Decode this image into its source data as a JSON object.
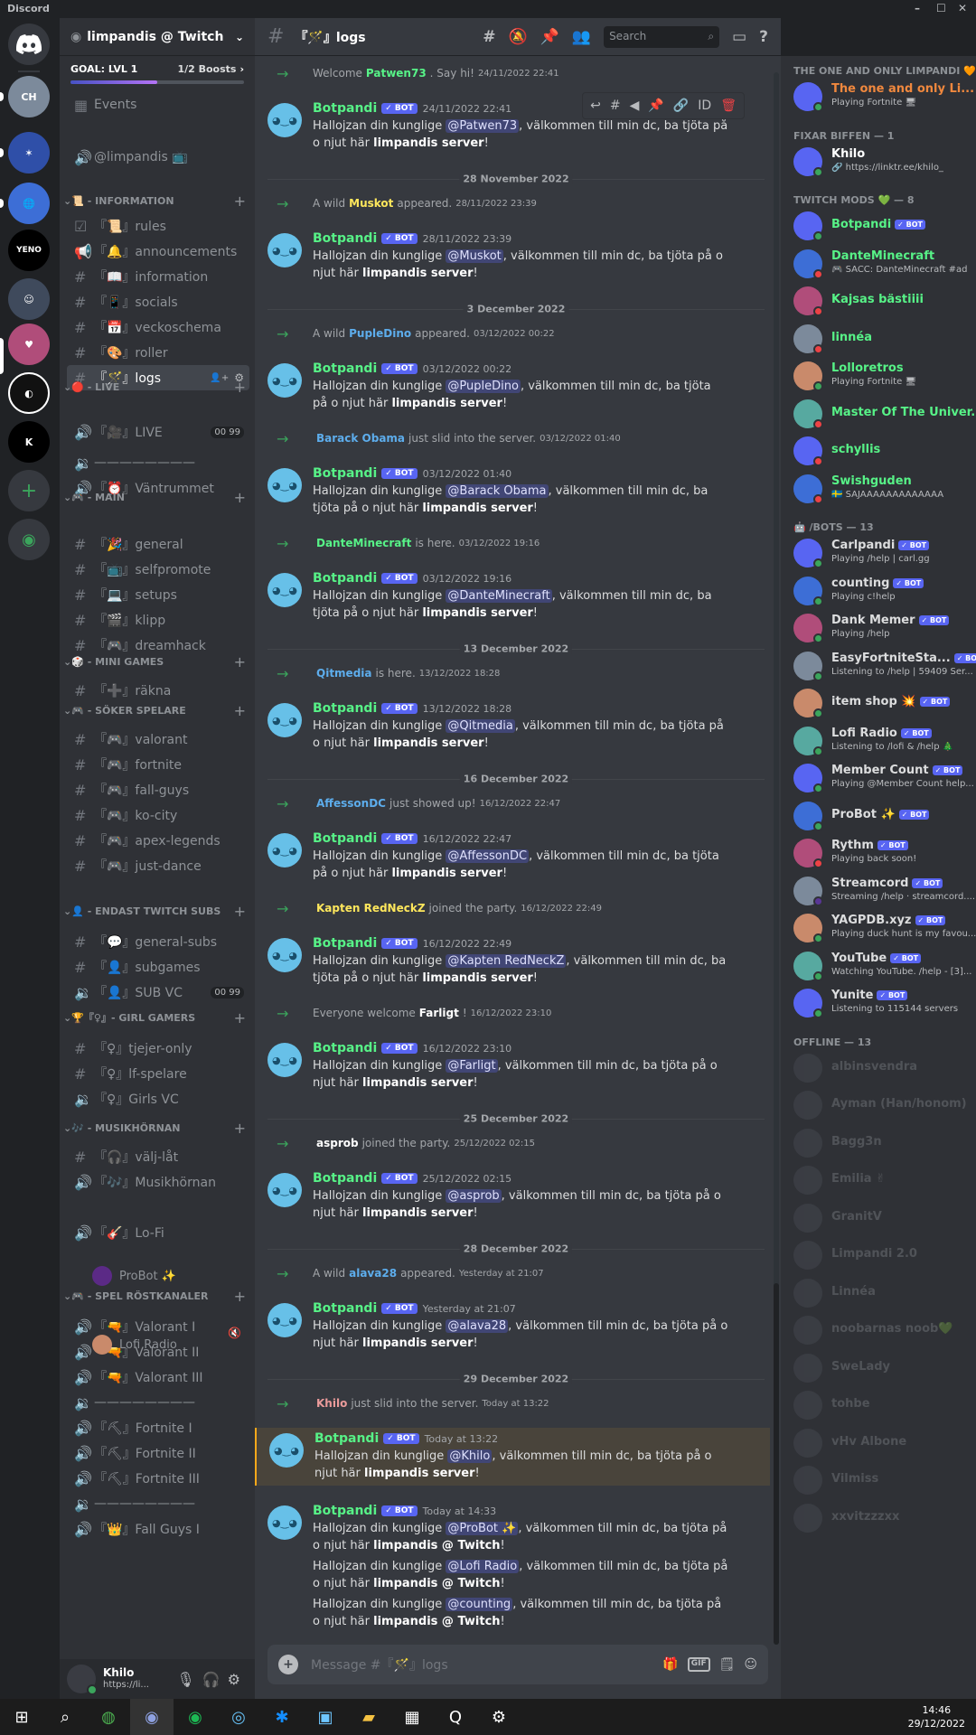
{
  "window": {
    "title": "Discord"
  },
  "server": {
    "name": "limpandis @ Twitch",
    "goal": "GOAL: LVL 1",
    "boosts": "1/2 Boosts",
    "goal_progress": 0.5
  },
  "channel_list": {
    "top": [
      {
        "label": "Events",
        "icon": "calendar-icon"
      },
      {
        "label": "@limpandis 📺",
        "icon": "voice-icon"
      }
    ],
    "categories": [
      {
        "name": "📜 - INFORMATION",
        "channels": [
          {
            "label": "『📜』rules",
            "icon": "checkbox-icon"
          },
          {
            "label": "『🔔』announcements",
            "icon": "megaphone-icon"
          },
          {
            "label": "『📖』information",
            "icon": "hash-icon"
          },
          {
            "label": "『📱』socials",
            "icon": "hash-icon"
          },
          {
            "label": "『📅』veckoschema",
            "icon": "hash-icon"
          },
          {
            "label": "『🎨』roller",
            "icon": "hash-icon"
          },
          {
            "label": "『🪄』logs",
            "icon": "hash-icon",
            "active": true
          }
        ]
      },
      {
        "name": "🔴 - LIVE",
        "channels": [
          {
            "label": "『🎥』LIVE",
            "icon": "speaker-icon",
            "badge_a": "00",
            "badge_b": "99"
          },
          {
            "label": "————————",
            "icon": "voice-lock-icon"
          },
          {
            "label": "『⏰』Väntrummet",
            "icon": "speaker-icon"
          }
        ]
      },
      {
        "name": "🎮 - MAIN",
        "channels": [
          {
            "label": "『🎉』general",
            "icon": "hash-icon"
          },
          {
            "label": "『📺』selfpromote",
            "icon": "hash-icon"
          },
          {
            "label": "『💻』setups",
            "icon": "hash-icon"
          },
          {
            "label": "『🎬』klipp",
            "icon": "hash-icon"
          },
          {
            "label": "『🎮』dreamhack",
            "icon": "hash-icon"
          }
        ]
      },
      {
        "name": "🎲 - MINI GAMES",
        "channels": [
          {
            "label": "『➕』räkna",
            "icon": "hash-icon"
          }
        ]
      },
      {
        "name": "🎮 - SÖKER SPELARE",
        "channels": [
          {
            "label": "『🎮』valorant",
            "icon": "hash-icon"
          },
          {
            "label": "『🎮』fortnite",
            "icon": "hash-icon"
          },
          {
            "label": "『🎮』fall-guys",
            "icon": "hash-icon"
          },
          {
            "label": "『🎮』ko-city",
            "icon": "hash-icon"
          },
          {
            "label": "『🎮』apex-legends",
            "icon": "hash-icon"
          },
          {
            "label": "『🎮』just-dance",
            "icon": "hash-icon"
          }
        ]
      },
      {
        "name": "👤 - ENDAST TWITCH SUBS",
        "channels": [
          {
            "label": "『💬』general-subs",
            "icon": "hash-icon"
          },
          {
            "label": "『👤』subgames",
            "icon": "hash-icon"
          },
          {
            "label": "『👤』SUB VC",
            "icon": "voice-lock-icon",
            "badge_a": "00",
            "badge_b": "99"
          }
        ]
      },
      {
        "name": "🏆『♀』- GIRL GAMERS",
        "channels": [
          {
            "label": "『♀』tjejer-only",
            "icon": "hash-icon"
          },
          {
            "label": "『♀』lf-spelare",
            "icon": "hash-icon"
          },
          {
            "label": "『♀』Girls VC",
            "icon": "voice-lock-icon"
          }
        ]
      },
      {
        "name": "🎶 - MUSIKHÖRNAN",
        "channels": [
          {
            "label": "『🎧』välj-låt",
            "icon": "hash-icon"
          },
          {
            "label": "『🎶』Musikhörnan",
            "icon": "speaker-icon"
          },
          {
            "label": "『🎸』Lo-Fi",
            "icon": "speaker-icon"
          }
        ]
      },
      {
        "name": "🎮 - SPEL RÖSTKANALER",
        "channels": [
          {
            "label": "『🔫』Valorant I",
            "icon": "speaker-icon"
          },
          {
            "label": "『🔫』Valorant II",
            "icon": "speaker-icon"
          },
          {
            "label": "『🔫』Valorant III",
            "icon": "speaker-icon"
          },
          {
            "label": "————————",
            "icon": "voice-lock-icon"
          },
          {
            "label": "『⛏』Fortnite I",
            "icon": "speaker-icon"
          },
          {
            "label": "『⛏』Fortnite II",
            "icon": "speaker-icon"
          },
          {
            "label": "『⛏』Fortnite III",
            "icon": "speaker-icon"
          },
          {
            "label": "————————",
            "icon": "voice-lock-icon"
          },
          {
            "label": "『👑』Fall Guys I",
            "icon": "speaker-icon"
          }
        ]
      }
    ],
    "voice_users": [
      {
        "name": "ProBot ✨"
      },
      {
        "name": "Lofi Radio"
      }
    ]
  },
  "user": {
    "name": "Khilo",
    "status": "https://li..."
  },
  "chat": {
    "channel": "『🪄』logs",
    "search_placeholder": "Search",
    "composer_placeholder": "Message #『🪄』logs",
    "bot_tag": "✓ BOT",
    "welcome_text": "Hallojzan din kunglige",
    "welcome_tail": ", välkommen till min dc, ba tjöta på o njut här",
    "items": [
      {
        "kind": "join",
        "pre": "Welcome",
        "name": "Patwen73",
        "post": ". Say hi!",
        "ts": "24/11/2022 22:41",
        "color": "#57f287"
      },
      {
        "kind": "bot",
        "ts": "24/11/2022 22:41",
        "mention": "@Patwen73",
        "server": "limpandis server"
      },
      {
        "kind": "divider",
        "date": "28 November 2022"
      },
      {
        "kind": "join",
        "pre": "A wild",
        "name": "Muskot",
        "post": "appeared.",
        "ts": "28/11/2022 23:39",
        "color": "#fee75c"
      },
      {
        "kind": "bot",
        "ts": "28/11/2022 23:39",
        "mention": "@Muskot",
        "server": "limpandis server"
      },
      {
        "kind": "divider",
        "date": "3 December 2022"
      },
      {
        "kind": "join",
        "pre": "A wild",
        "name": "PupleDino",
        "post": "appeared.",
        "ts": "03/12/2022 00:22",
        "color": "#5dadec"
      },
      {
        "kind": "bot",
        "ts": "03/12/2022 00:22",
        "mention": "@PupleDino",
        "server": "limpandis server"
      },
      {
        "kind": "join",
        "pre": "",
        "name": "Barack Obama",
        "post": "just slid into the server.",
        "ts": "03/12/2022 01:40",
        "color": "#5dadec"
      },
      {
        "kind": "bot",
        "ts": "03/12/2022 01:40",
        "mention": "@Barack Obama",
        "server": "limpandis server"
      },
      {
        "kind": "join",
        "pre": "",
        "name": "DanteMinecraft",
        "post": "is here.",
        "ts": "03/12/2022 19:16",
        "color": "#57f287"
      },
      {
        "kind": "bot",
        "ts": "03/12/2022 19:16",
        "mention": "@DanteMinecraft",
        "server": "limpandis server"
      },
      {
        "kind": "divider",
        "date": "13 December 2022"
      },
      {
        "kind": "join",
        "pre": "",
        "name": "Qitmedia",
        "post": "is here.",
        "ts": "13/12/2022 18:28",
        "color": "#5dadec"
      },
      {
        "kind": "bot",
        "ts": "13/12/2022 18:28",
        "mention": "@Qitmedia",
        "server": "limpandis server"
      },
      {
        "kind": "divider",
        "date": "16 December 2022"
      },
      {
        "kind": "join",
        "pre": "",
        "name": "AffessonDC",
        "post": "just showed up!",
        "ts": "16/12/2022 22:47",
        "color": "#5dadec"
      },
      {
        "kind": "bot",
        "ts": "16/12/2022 22:47",
        "mention": "@AffessonDC",
        "server": "limpandis server"
      },
      {
        "kind": "join",
        "pre": "",
        "name": "Kapten RedNeckZ",
        "post": "joined the party.",
        "ts": "16/12/2022 22:49",
        "color": "#fee75c"
      },
      {
        "kind": "bot",
        "ts": "16/12/2022 22:49",
        "mention": "@Kapten RedNeckZ",
        "server": "limpandis server"
      },
      {
        "kind": "join",
        "pre": "Everyone welcome",
        "name": "Farligt",
        "post": "!",
        "ts": "16/12/2022 23:10",
        "color": "#ffffff"
      },
      {
        "kind": "bot",
        "ts": "16/12/2022 23:10",
        "mention": "@Farligt",
        "server": "limpandis server"
      },
      {
        "kind": "divider",
        "date": "25 December 2022"
      },
      {
        "kind": "join",
        "pre": "",
        "name": "asprob",
        "post": "joined the party.",
        "ts": "25/12/2022 02:15",
        "color": "#ffffff"
      },
      {
        "kind": "bot",
        "ts": "25/12/2022 02:15",
        "mention": "@asprob",
        "server": "limpandis server"
      },
      {
        "kind": "divider",
        "date": "28 December 2022"
      },
      {
        "kind": "join",
        "pre": "A wild",
        "name": "alava28",
        "post": "appeared.",
        "ts": "Yesterday at 21:07",
        "color": "#5dadec"
      },
      {
        "kind": "bot",
        "ts": "Yesterday at 21:07",
        "mention": "@alava28",
        "server": "limpandis server"
      },
      {
        "kind": "divider",
        "date": "29 December 2022"
      },
      {
        "kind": "join",
        "pre": "",
        "name": "Khilo",
        "post": "just slid into the server.",
        "ts": "Today at 13:22",
        "color": "#eb9b9b"
      },
      {
        "kind": "bot",
        "ts": "Today at 13:22",
        "mention": "@Khilo",
        "server": "limpandis server",
        "highlight": true
      },
      {
        "kind": "bot3",
        "ts": "Today at 14:33",
        "mentions": [
          "@ProBot ✨",
          "@Lofi Radio",
          "@counting"
        ],
        "server": "limpandis @ Twitch"
      }
    ]
  },
  "members": {
    "groups": [
      {
        "title": "THE ONE AND ONLY LIMPANDI 🧡 — 1",
        "list": [
          {
            "name": "The one and only Li...",
            "sub": "Playing Fortnite 🖥",
            "color": "#f0883e",
            "status": "#3ba55c"
          }
        ]
      },
      {
        "title": "FIXAR BIFFEN — 1",
        "list": [
          {
            "name": "Khilo",
            "sub": "🔗 https://linktr.ee/khilo_",
            "color": "#ffffff",
            "status": "#3ba55c"
          }
        ]
      },
      {
        "title": "TWITCH MODS 💚 — 8",
        "list": [
          {
            "name": "Botpandi",
            "bot": true,
            "color": "#57f287",
            "status": "#3ba55c"
          },
          {
            "name": "DanteMinecraft",
            "sub": "🎮 SACC: DanteMinecraft #ad",
            "color": "#57f287",
            "status": "#ed4245"
          },
          {
            "name": "Kajsas bästiiii",
            "color": "#57f287",
            "status": "#ed4245"
          },
          {
            "name": "linnéa",
            "color": "#57f287",
            "status": "#ed4245"
          },
          {
            "name": "Lolloretros",
            "sub": "Playing Fortnite 🖥",
            "color": "#57f287",
            "status": "#3ba55c"
          },
          {
            "name": "Master Of The Univer...",
            "color": "#57f287",
            "status": "#ed4245"
          },
          {
            "name": "schyllis",
            "color": "#57f287",
            "status": "#ed4245"
          },
          {
            "name": "Swishguden",
            "sub": "🇸🇪 SÄJAAAAAAAAAAAAA",
            "color": "#57f287",
            "status": "#ed4245"
          }
        ]
      },
      {
        "title": "🤖 /BOTS — 13",
        "list": [
          {
            "name": "Carlpandi",
            "bot": true,
            "sub": "Playing /help | carl.gg",
            "color": "#dcddde",
            "status": "#3ba55c"
          },
          {
            "name": "counting",
            "bot": true,
            "sub": "Playing c!help",
            "color": "#dcddde",
            "status": "#3ba55c"
          },
          {
            "name": "Dank Memer",
            "bot": true,
            "sub": "Playing /help",
            "color": "#dcddde",
            "status": "#3ba55c"
          },
          {
            "name": "EasyFortniteSta...",
            "bot": true,
            "sub": "Listening to /help | 59409 Ser...",
            "color": "#dcddde",
            "status": "#3ba55c"
          },
          {
            "name": "item shop 💥",
            "bot": true,
            "color": "#dcddde",
            "status": "#3ba55c"
          },
          {
            "name": "Lofi Radio",
            "bot": true,
            "sub": "Listening to /lofi & /help 🎄",
            "color": "#dcddde",
            "status": "#3ba55c"
          },
          {
            "name": "Member Count",
            "bot": true,
            "sub": "Playing @Member Count help...",
            "color": "#dcddde",
            "status": "#3ba55c"
          },
          {
            "name": "ProBot ✨",
            "bot": true,
            "color": "#dcddde",
            "status": "#3ba55c"
          },
          {
            "name": "Rythm",
            "bot": true,
            "sub": "Playing back soon!",
            "color": "#dcddde",
            "status": "#ed4245"
          },
          {
            "name": "Streamcord",
            "bot": true,
            "sub": "Streaming /help · streamcord....",
            "color": "#dcddde",
            "status": "#593695"
          },
          {
            "name": "YAGPDB.xyz",
            "bot": true,
            "sub": "Playing duck hunt is my favou...",
            "color": "#dcddde",
            "status": "#3ba55c"
          },
          {
            "name": "YouTube",
            "bot": true,
            "sub": "Watching YouTube. /help - [3]...",
            "color": "#dcddde",
            "status": "#3ba55c"
          },
          {
            "name": "Yunite",
            "bot": true,
            "sub": "Listening to 115144 servers",
            "color": "#dcddde",
            "status": "#3ba55c"
          }
        ]
      },
      {
        "title": "OFFLINE — 13",
        "offline": true,
        "list": [
          {
            "name": "albinsvendra",
            "color": "#3ba55c"
          },
          {
            "name": "Ayman (Han/honom)",
            "color": "#eb9b9b"
          },
          {
            "name": "Bagg3n",
            "color": "#ed4245"
          },
          {
            "name": "Emilia ✌",
            "color": "#f0883e"
          },
          {
            "name": "GranitV",
            "color": "#57f287"
          },
          {
            "name": "Limpandi 2.0",
            "color": "#ed4245"
          },
          {
            "name": "Linnéa",
            "color": "#57f287"
          },
          {
            "name": "noobarnas noob💚",
            "color": "#57f287"
          },
          {
            "name": "SweLady",
            "color": "#57f287"
          },
          {
            "name": "tohbe",
            "color": "#57f287"
          },
          {
            "name": "vHv Albone",
            "color": "#57f287"
          },
          {
            "name": "Vilmiss",
            "color": "#57f287"
          },
          {
            "name": "xxvitzzzxx",
            "color": "#57f287"
          }
        ]
      }
    ]
  },
  "taskbar": {
    "time": "14:46",
    "date": "29/12/2022"
  },
  "colors": {
    "accent": "#5865f2",
    "online": "#3ba55c",
    "dnd": "#ed4245",
    "bg": "#36393f"
  }
}
